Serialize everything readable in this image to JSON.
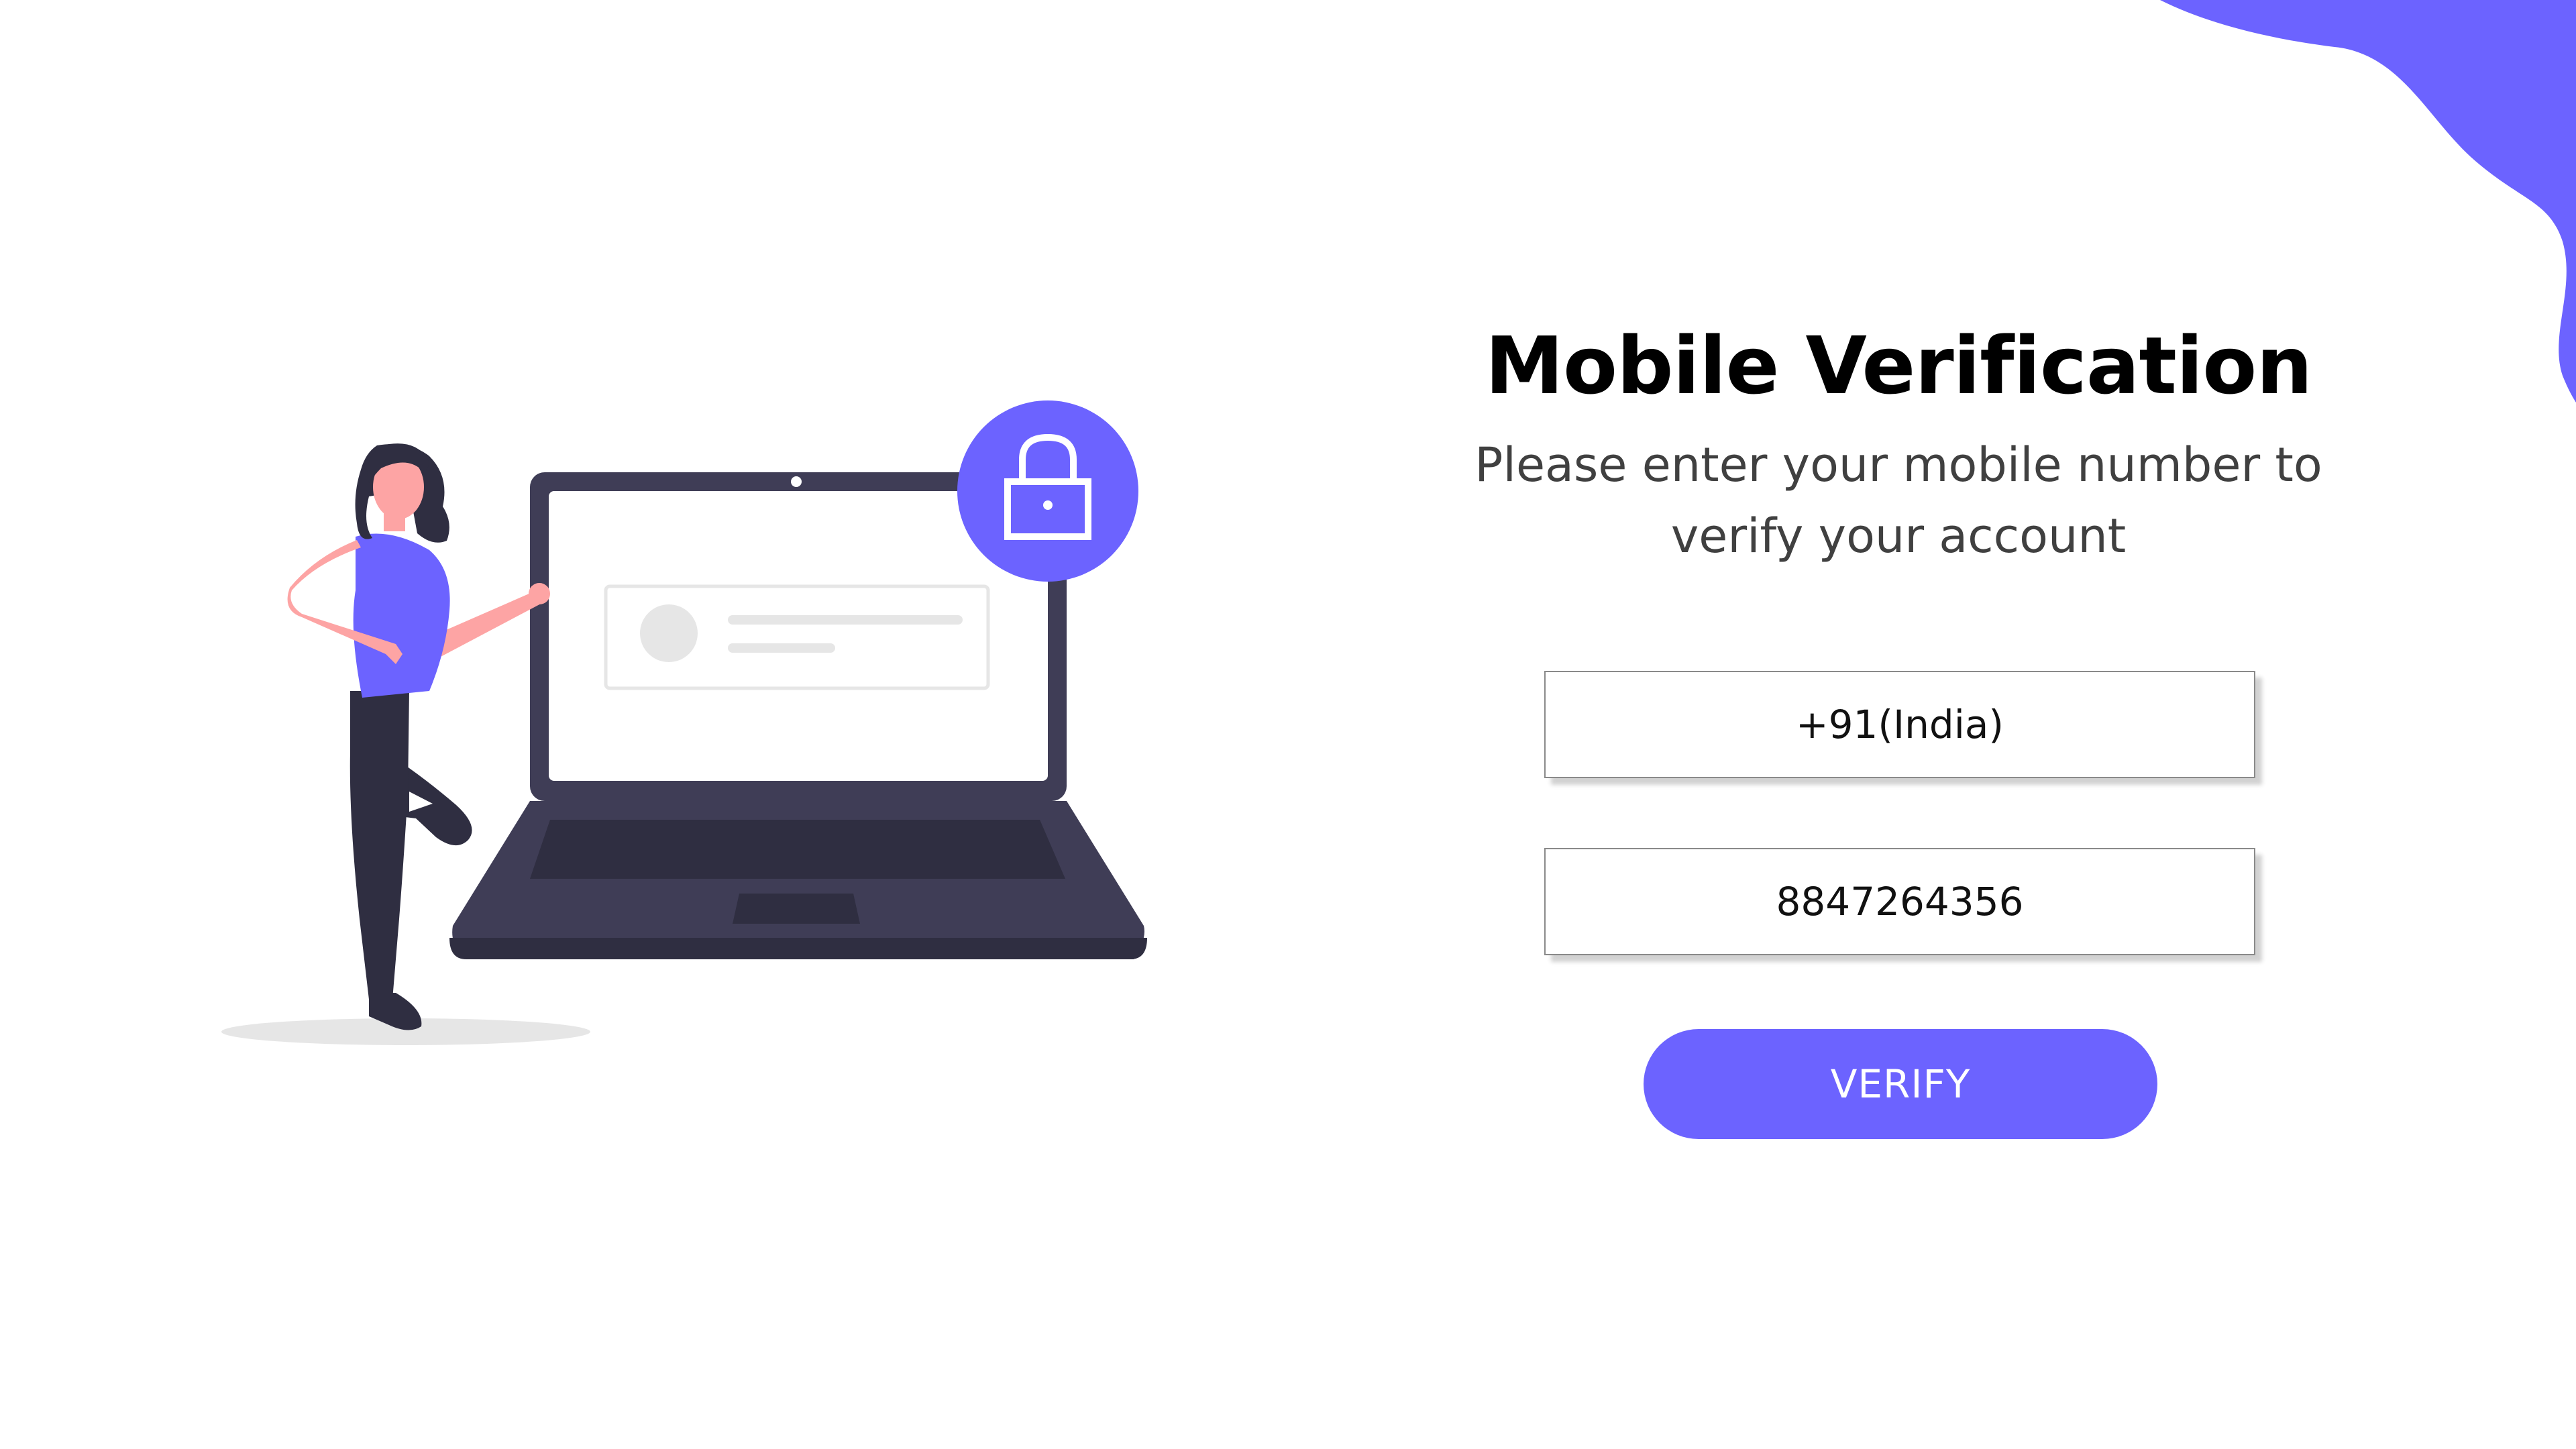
{
  "title": "Mobile Verification",
  "subtitle": "Please enter your mobile number to verify your account",
  "country_field": {
    "value": "+91(India)"
  },
  "phone_field": {
    "value": "8847264356"
  },
  "verify_button": {
    "label": "VERIFY"
  },
  "colors": {
    "accent": "#6c63ff",
    "laptop": "#3f3d56",
    "skin": "#fda4a4",
    "background": "#ffffff"
  },
  "icons": {
    "illustration": "woman-with-laptop-illustration",
    "lock": "lock-icon",
    "corner": "corner-blob-decoration"
  }
}
